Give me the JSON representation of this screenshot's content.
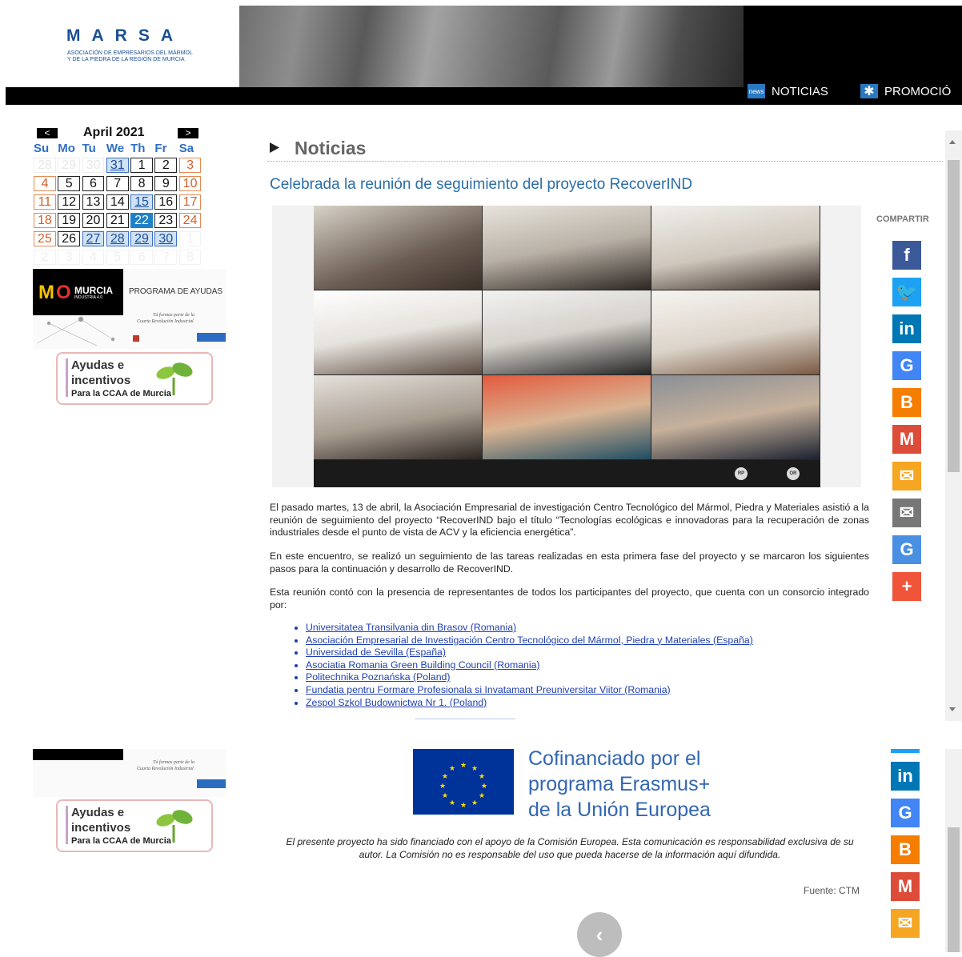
{
  "header": {
    "logo_title": "MARSA",
    "logo_subtitle_1": "ASOCIACIÓN DE EMPRESARIOS DEL MÁRMOL",
    "logo_subtitle_2": "Y DE LA PIEDRA DE LA REGIÓN DE MURCIA",
    "nav": [
      {
        "label": "NOTICIAS",
        "icon_text": "news",
        "icon": "news-icon"
      },
      {
        "label": "PROMOCIÓ",
        "icon_text": "✱",
        "icon": "asterisk-icon"
      }
    ]
  },
  "calendar": {
    "prev": "<",
    "next": ">",
    "month_title": "April 2021",
    "weekdays": [
      "Su",
      "Mo",
      "Tu",
      "We",
      "Th",
      "Fr",
      "Sa"
    ],
    "weeks": [
      [
        "28",
        "29",
        "30",
        "31",
        "1",
        "2",
        "3"
      ],
      [
        "4",
        "5",
        "6",
        "7",
        "8",
        "9",
        "10"
      ],
      [
        "11",
        "12",
        "13",
        "14",
        "15",
        "16",
        "17"
      ],
      [
        "18",
        "19",
        "20",
        "21",
        "22",
        "23",
        "24"
      ],
      [
        "25",
        "26",
        "27",
        "28",
        "29",
        "30",
        "1"
      ],
      [
        "2",
        "3",
        "4",
        "5",
        "6",
        "7",
        "8"
      ]
    ]
  },
  "sidebar": {
    "ad1_brand": "MURCIA",
    "ad1_brand_sub": "INDUSTRIA 4.0",
    "ad1_program": "PROGRAMA DE AYUDAS",
    "ad1_tagline_1": "Tú formas parte de la",
    "ad1_tagline_2": "Cuarta Revolución Industrial",
    "ayudas_line1": "Ayudas e",
    "ayudas_line2": "incentivos",
    "ayudas_line3": "Para la CCAA de Murcia"
  },
  "main": {
    "section_title": "Noticias",
    "article_title": "Celebrada la reunión de seguimiento del proyecto RecoverIND",
    "paragraph_1": "El pasado martes, 13 de abril, la Asociación Empresarial de investigación Centro Tecnológico del Mármol, Piedra y Materiales asistió a la reunión de seguimiento del proyecto “RecoverIND bajo el título “Tecnologías ecológicas e innovadoras para la recuperación de zonas industriales desde el punto de vista de ACV y la eficiencia energética”.",
    "paragraph_2": "En este encuentro, se realizó un seguimiento de las tareas realizadas en esta primera fase del proyecto y se marcaron los siguientes pasos para la continuación y desarrollo de RecoverIND.",
    "paragraph_3": "Esta reunión contó con la presencia de representantes de todos los participantes del proyecto, que cuenta con un consorcio integrado por:",
    "partners": [
      "Universitatea Transilvania din Brasov (Romania)",
      "Asociación Empresarial de Investigación Centro Tecnológico del Mármol, Piedra y Materiales (España)",
      "Universidad de Sevilla (España)",
      "Asociatia Romania Green Building Council (Romania)",
      "Politechnika Poznańska (Poland)",
      "Fundatia pentru Formare Profesionala si Invatamant Preuniversitar Viitor (Romania)",
      "Zespol Szkol Budownictwa Nr 1. (Poland)"
    ],
    "video_badges": [
      "RP",
      "OR"
    ]
  },
  "share": {
    "label": "COMPARTIR",
    "buttons": [
      {
        "name": "facebook-icon",
        "glyph": "f",
        "color": "#3b5998"
      },
      {
        "name": "twitter-icon",
        "glyph": "🐦",
        "color": "#1da1f2"
      },
      {
        "name": "linkedin-icon",
        "glyph": "in",
        "color": "#0077b5"
      },
      {
        "name": "google-icon",
        "glyph": "G",
        "color": "#4285f4"
      },
      {
        "name": "blogger-icon",
        "glyph": "B",
        "color": "#f57d00"
      },
      {
        "name": "gmail-icon",
        "glyph": "M",
        "color": "#dd4b39"
      },
      {
        "name": "mail-orange-icon",
        "glyph": "✉",
        "color": "#f5a623"
      },
      {
        "name": "email-icon",
        "glyph": "✉",
        "color": "#777777"
      },
      {
        "name": "translate-icon",
        "glyph": "G",
        "color": "#4a90e2"
      },
      {
        "name": "more-icon",
        "glyph": "+",
        "color": "#f0553a"
      }
    ],
    "lower_buttons": [
      {
        "name": "linkedin-icon",
        "glyph": "in",
        "color": "#0077b5"
      },
      {
        "name": "google-icon",
        "glyph": "G",
        "color": "#4285f4"
      },
      {
        "name": "blogger-icon",
        "glyph": "B",
        "color": "#f57d00"
      },
      {
        "name": "gmail-icon",
        "glyph": "M",
        "color": "#dd4b39"
      },
      {
        "name": "mail-orange-icon",
        "glyph": "✉",
        "color": "#f5a623"
      }
    ]
  },
  "footer": {
    "eu_line1": "Cofinanciado por el",
    "eu_line2": "programa Erasmus+",
    "eu_line3": "de la Unión Europea",
    "eu_note": "El presente proyecto ha sido financiado con el apoyo de la Comisión Europea. Esta comunicación es responsabilidad exclusiva de su autor. La Comisión no es responsable del uso que pueda hacerse de la información aquí difundida.",
    "source": "Fuente: CTM",
    "prev_glyph": "‹"
  },
  "colors": {
    "brand_blue": "#1b4f92",
    "link_blue": "#2b6ea8",
    "eu_blue": "#003399"
  }
}
